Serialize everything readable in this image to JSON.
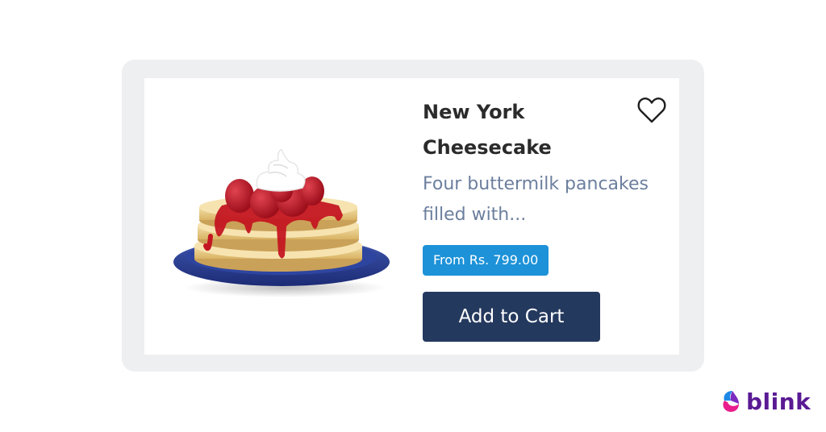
{
  "product": {
    "title": "New York Cheesecake",
    "description": "Four buttermilk pancakes filled with...",
    "price_label": "From Rs. 799.00",
    "add_to_cart_label": "Add to Cart",
    "favorite_icon": "heart-outline-icon",
    "image_subject": "pancake stack with strawberries, syrup and whipped cream on blue plate"
  },
  "brand": {
    "name": "blink",
    "icon": "blink-logo-icon"
  },
  "colors": {
    "card_frame": "#eeeff1",
    "title_text": "#2b2b2b",
    "description_text": "#6c7f9e",
    "price_badge": "#1d92d8",
    "cart_button": "#24395e",
    "brand_text": "#5a1a94"
  }
}
